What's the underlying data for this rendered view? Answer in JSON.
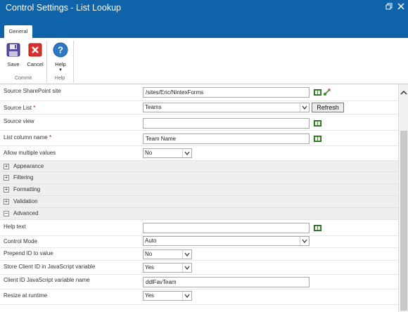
{
  "window": {
    "title": "Control Settings - List Lookup"
  },
  "ribbon": {
    "tab": "General",
    "buttons": {
      "save": "Save",
      "cancel": "Cancel",
      "help": "Help"
    },
    "groups": {
      "commit": "Commit",
      "help": "Help"
    }
  },
  "form": {
    "source_site": {
      "label": "Source SharePoint site",
      "value": "/sites/Eric/NintexForms"
    },
    "source_list": {
      "label": "Source List",
      "required": "*",
      "value": "Teams",
      "refresh": "Refresh"
    },
    "source_view": {
      "label": "Source view",
      "value": ""
    },
    "list_column": {
      "label": "List column name",
      "required": "*",
      "value": "Team Name"
    },
    "allow_multiple": {
      "label": "Allow multiple values",
      "value": "No"
    },
    "sections": {
      "appearance": "Appearance",
      "filtering": "Filtering",
      "formatting": "Formatting",
      "validation": "Validation",
      "advanced": "Advanced"
    },
    "help_text": {
      "label": "Help text",
      "value": ""
    },
    "control_mode": {
      "label": "Control Mode",
      "value": "Auto"
    },
    "prepend_id": {
      "label": "Prepend ID to value",
      "value": "No"
    },
    "store_client_id": {
      "label": "Store Client ID in JavaScript variable",
      "value": "Yes"
    },
    "client_id_var": {
      "label": "Client ID JavaScript variable name",
      "value": "ddlFavTeam"
    },
    "resize": {
      "label": "Resize at runtime",
      "value": "Yes"
    }
  },
  "icons": {
    "expand": "+",
    "collapse": "−"
  }
}
